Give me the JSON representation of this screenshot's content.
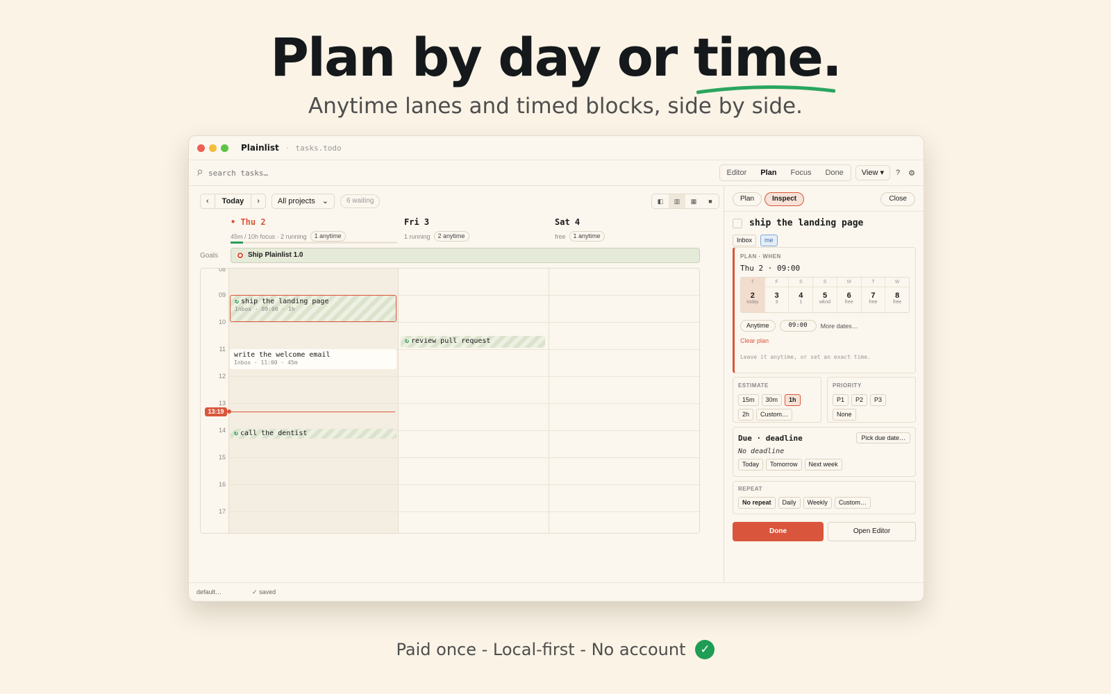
{
  "hero": {
    "title_main": "Plan by day or ",
    "title_highlight": "time.",
    "subtitle": "Anytime lanes and timed blocks, side by side.",
    "footer": "Paid once - Local-first - No account",
    "accent_green": "#1f9d55"
  },
  "window": {
    "app_name": "Plainlist",
    "separator": "·",
    "file_name": "tasks.todo"
  },
  "toolbar": {
    "search_placeholder": "search tasks…",
    "modes": [
      "Editor",
      "Plan",
      "Focus",
      "Done"
    ],
    "active_mode": "Plan",
    "view_label": "View ▾",
    "help_label": "?",
    "settings_icon": "gear-icon"
  },
  "calendar": {
    "prev": "‹",
    "today": "Today",
    "next": "›",
    "project_filter": "All projects",
    "project_chevron": "⌄",
    "waiting": "6 waiting",
    "goals_label": "Goals",
    "goal_title": "Ship Plainlist 1.0",
    "days": [
      {
        "name": "• Thu 2",
        "meta_text": "45m / 10h focus · 2 running",
        "pill": "1 anytime",
        "is_today": true,
        "focus_progress": 0.075
      },
      {
        "name": "Fri 3",
        "meta_text": "1 running",
        "pill": "2 anytime",
        "is_today": false
      },
      {
        "name": "Sat 4",
        "meta_text": "free",
        "pill": "1 anytime",
        "is_today": false
      }
    ],
    "hours": [
      "08",
      "09",
      "10",
      "11",
      "12",
      "13",
      "14",
      "15",
      "16",
      "17"
    ],
    "now_label": "13:19",
    "events": [
      {
        "title": "ship the landing page",
        "sub": "Inbox · 09:00 · 1h",
        "repeat_icon": "↻"
      },
      {
        "title": "review pull request",
        "repeat_icon": "↻"
      },
      {
        "title": "write the welcome email",
        "sub": "Inbox · 11:00 · 45m"
      },
      {
        "title": "call the dentist",
        "repeat_icon": "↻"
      }
    ]
  },
  "status": {
    "left": "default…",
    "saved": "✓ saved"
  },
  "inspector": {
    "tabs": [
      "Plan",
      "Inspect"
    ],
    "active_tab": "Inspect",
    "close": "Close",
    "task_title": "ship the landing page",
    "tags": [
      "Inbox",
      "me"
    ],
    "plan_label": "PLAN · WHEN",
    "when_value": "Thu 2 · 09:00",
    "date_strip": [
      {
        "dow": "T",
        "num": "2",
        "note": "today"
      },
      {
        "dow": "F",
        "num": "3",
        "note": "3"
      },
      {
        "dow": "S",
        "num": "4",
        "note": "1"
      },
      {
        "dow": "S",
        "num": "5",
        "note": "wknd"
      },
      {
        "dow": "M",
        "num": "6",
        "note": "free"
      },
      {
        "dow": "T",
        "num": "7",
        "note": "free"
      },
      {
        "dow": "W",
        "num": "8",
        "note": "free"
      }
    ],
    "anytime": "Anytime",
    "time_value": "09:00",
    "more_dates": "More dates…",
    "clear_plan": "Clear plan",
    "hint": "Leave it anytime, or set an exact time.",
    "estimate_label": "ESTIMATE",
    "estimates": [
      "15m",
      "30m",
      "1h",
      "2h",
      "Custom…"
    ],
    "active_estimate": "1h",
    "priority_label": "PRIORITY",
    "priorities": [
      "P1",
      "P2",
      "P3",
      "None"
    ],
    "due_title": "Due · deadline",
    "pick_due": "Pick due date…",
    "no_deadline": "No deadline",
    "due_quick": [
      "Today",
      "Tomorrow",
      "Next week"
    ],
    "repeat_label": "REPEAT",
    "repeats": [
      "No repeat",
      "Daily",
      "Weekly",
      "Custom…"
    ],
    "active_repeat": "No repeat",
    "done": "Done",
    "open_editor": "Open Editor",
    "accent": "#d9553b"
  }
}
